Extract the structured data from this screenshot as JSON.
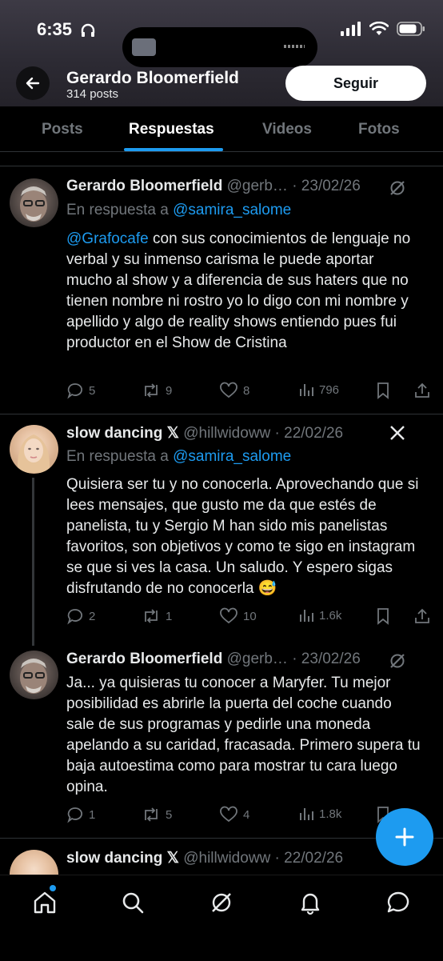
{
  "status_bar": {
    "time": "6:35"
  },
  "profile": {
    "name": "Gerardo Bloomerfield",
    "posts": "314 posts",
    "follow_label": "Seguir"
  },
  "tabs": [
    "Posts",
    "Respuestas",
    "Videos",
    "Fotos"
  ],
  "tweets": [
    {
      "name": "Gerardo Bloomerfield",
      "handle": "@gerb… · 23/02/26",
      "reply_prefix": "En respuesta a ",
      "reply_to": "@samira_salome",
      "mention": "@Grafocafe",
      "body": " con sus conocimientos de lenguaje no verbal y su inmenso carisma le puede aportar mucho al show y a diferencia de sus haters que no tienen nombre ni rostro yo lo digo con mi nombre y apellido y algo de reality shows entiendo pues fui productor en el Show de Cristina",
      "replies": "5",
      "reposts": "9",
      "likes": "8",
      "views": "796"
    },
    {
      "name": "slow dancing 𝕏",
      "handle": "@hillwidoww · 22/02/26",
      "reply_prefix": "En respuesta a ",
      "reply_to": "@samira_salome",
      "body": "Quisiera ser tu y no conocerla. Aprovechando que si lees mensajes, que gusto me da que estés de panelista, tu y Sergio M han sido mis panelistas favoritos, son objetivos y como te sigo en instagram se que si ves la casa.  Un saludo.  Y espero sigas disfrutando de no  conocerla 😅",
      "replies": "2",
      "reposts": "1",
      "likes": "10",
      "views": "1.6k"
    },
    {
      "name": "Gerardo Bloomerfield",
      "handle": "@gerb… · 23/02/26",
      "body": "Ja... ya quisieras tu conocer a Maryfer. Tu mejor posibilidad es abrirle la puerta del coche cuando sale de sus programas y pedirle una moneda apelando a su caridad, fracasada. Primero supera tu baja autoestima como para mostrar tu cara luego opina.",
      "replies": "1",
      "reposts": "5",
      "likes": "4",
      "views": "1.8k"
    },
    {
      "name": "slow dancing 𝕏",
      "handle": "@hillwidoww · 22/02/26"
    }
  ],
  "colors": {
    "accent": "#1d9bf0",
    "background": "#000000",
    "muted": "#71767b"
  }
}
